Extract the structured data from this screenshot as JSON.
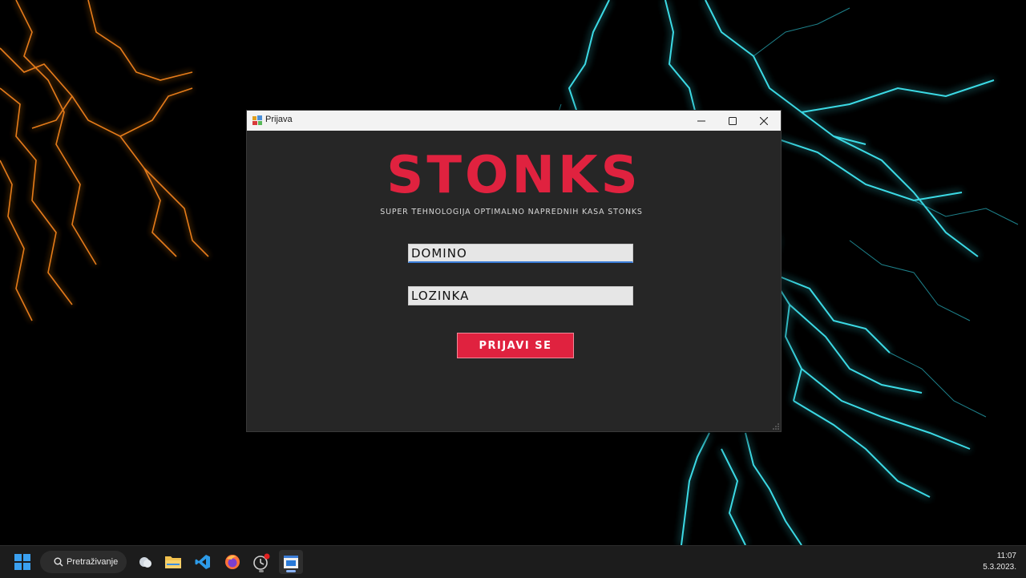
{
  "window": {
    "title": "Prijava",
    "controls": {
      "minimize": "minimize-icon",
      "maximize": "maximize-icon",
      "close": "close-icon"
    }
  },
  "app": {
    "logo": "STONKS",
    "tagline": "SUPER TEHNOLOGIJA OPTIMALNO NAPREDNIH KASA STONKS",
    "username": {
      "value": "DOMINO"
    },
    "password": {
      "value": "LOZINKA"
    },
    "login_label": "PRIJAVI SE",
    "colors": {
      "accent": "#e0223f",
      "background": "#262626",
      "field": "#e6e6e6"
    }
  },
  "taskbar": {
    "search_label": "Pretraživanje",
    "icons": [
      "windows-start-icon",
      "search-icon",
      "weather-icon",
      "file-explorer-icon",
      "vscode-icon",
      "firefox-icon",
      "app-icon-notification",
      "stonks-app-icon"
    ],
    "clock": {
      "time": "11:07",
      "date": "5.3.2023."
    }
  }
}
